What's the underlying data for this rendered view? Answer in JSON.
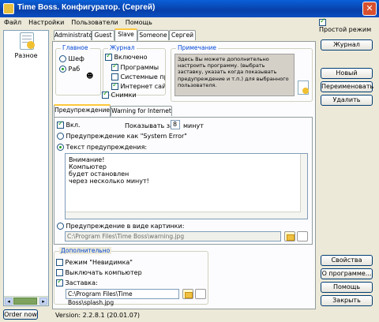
{
  "window": {
    "title": "Time Boss. Конфигуратор. (Сергей)"
  },
  "menu": [
    "Файл",
    "Настройки",
    "Пользователи",
    "Помощь"
  ],
  "simple_mode": {
    "label": "Простой режим",
    "checked": true
  },
  "sidebar": {
    "item_label": "Разное",
    "order_button": "Order now",
    "version": "Version: 2.2.8.1 (20.01.07)"
  },
  "user_tabs": [
    "Administrator",
    "Guest",
    "Slave",
    "Someone",
    "Сергей"
  ],
  "main_group": {
    "title": "Главное",
    "options": [
      "Шеф",
      "Раб"
    ]
  },
  "log_group": {
    "title": "Журнал",
    "enabled": "Включено",
    "items": [
      "Программы",
      "Системные прог",
      "Интернет сайты",
      "Снимки"
    ]
  },
  "note": {
    "title": "Примечание",
    "text": "Здесь Вы можете дополнительно настроить программу. (выбрать заставку, указать когда показывать предупреждение и т.п.) для выбранного пользователя."
  },
  "right_buttons": {
    "log": "Журнал",
    "new": "Новый",
    "rename": "Переименовать",
    "delete": "Удалить",
    "properties": "Свойства",
    "about": "О программе...",
    "help": "Помощь",
    "close": "Закрыть"
  },
  "warn_tabs": [
    "Предупреждение",
    "Warning for Internet"
  ],
  "warning": {
    "on_label": "Вкл.",
    "show_for": "Показывать за",
    "minutes_value": "8",
    "minutes_label": "минут",
    "sys_error": "Предупреждение как \"System Error\"",
    "text_label": "Текст предупреждения:",
    "text_lines": [
      "Внимание!",
      "Компьютер",
      "будет остановлен",
      "через несколько минут!"
    ],
    "image_label": "Предупреждение в виде картинки:",
    "image_path": "C:\\Program Files\\Time Boss\\warning.jpg"
  },
  "extra": {
    "title": "Дополнительно",
    "invisible": "Режим \"Невидимка\"",
    "shutdown": "Выключать компьютер",
    "splash_label": "Заставка:",
    "splash_path": "C:\\Program Files\\Time Boss\\splash.jpg"
  },
  "colors": {
    "title_bar": "#0a4ec2",
    "accent_green": "#21a121",
    "group_title": "#0046d5"
  }
}
